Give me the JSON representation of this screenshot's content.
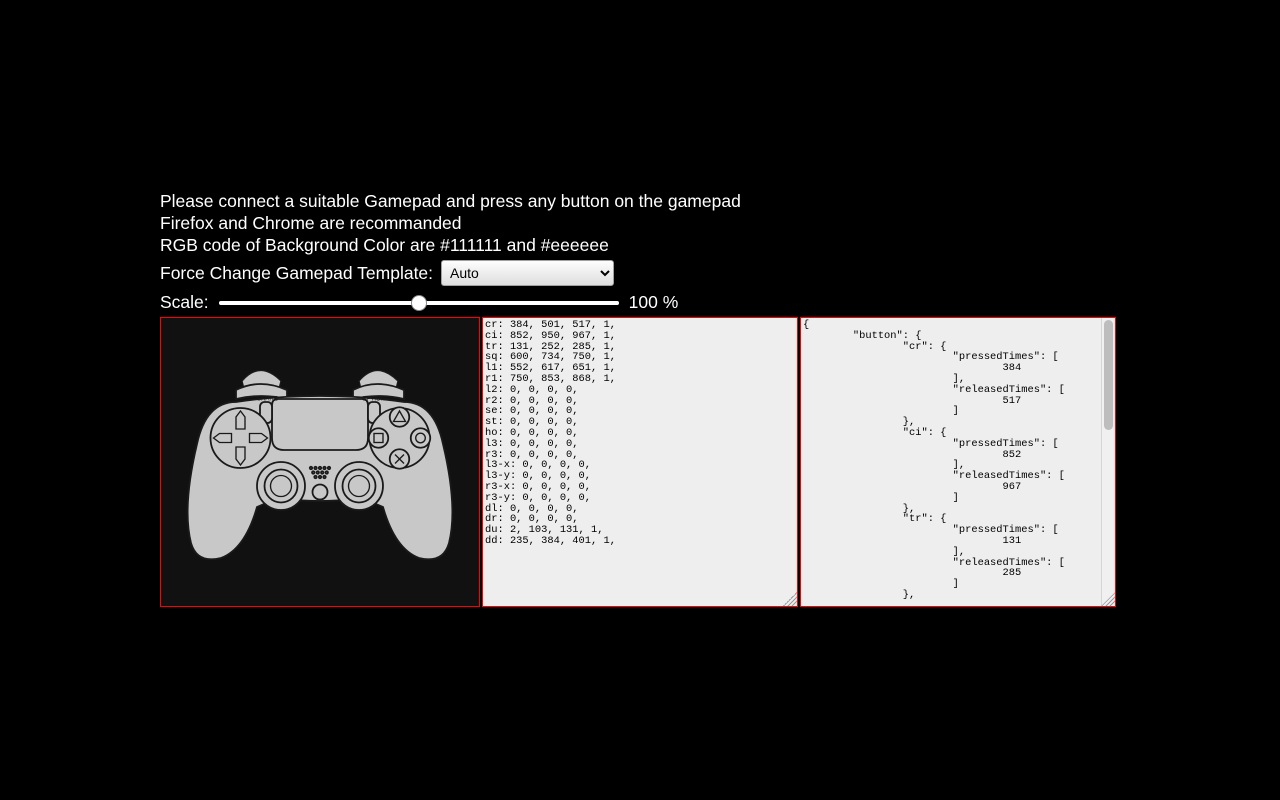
{
  "info": {
    "line1": "Please connect a suitable Gamepad and press any button on the gamepad",
    "line2": "Firefox and Chrome are recommanded",
    "line3": "RGB code of Background Color are #111111 and #eeeeee"
  },
  "template": {
    "label": "Force Change Gamepad Template:",
    "selected": "Auto"
  },
  "scale": {
    "label": "Scale:",
    "value": 100,
    "suffix": " %"
  },
  "raw_lines": [
    "cr: 384, 501, 517, 1,",
    "ci: 852, 950, 967, 1,",
    "tr: 131, 252, 285, 1,",
    "sq: 600, 734, 750, 1,",
    "l1: 552, 617, 651, 1,",
    "r1: 750, 853, 868, 1,",
    "l2: 0, 0, 0, 0,",
    "r2: 0, 0, 0, 0,",
    "se: 0, 0, 0, 0,",
    "st: 0, 0, 0, 0,",
    "ho: 0, 0, 0, 0,",
    "l3: 0, 0, 0, 0,",
    "r3: 0, 0, 0, 0,",
    "l3-x: 0, 0, 0, 0,",
    "l3-y: 0, 0, 0, 0,",
    "r3-x: 0, 0, 0, 0,",
    "r3-y: 0, 0, 0, 0,",
    "dl: 0, 0, 0, 0,",
    "dr: 0, 0, 0, 0,",
    "du: 2, 103, 131, 1,",
    "dd: 235, 384, 401, 1,"
  ],
  "json_visible": "{\n        \"button\": {\n                \"cr\": {\n                        \"pressedTimes\": [\n                                384\n                        ],\n                        \"releasedTimes\": [\n                                517\n                        ]\n                },\n                \"ci\": {\n                        \"pressedTimes\": [\n                                852\n                        ],\n                        \"releasedTimes\": [\n                                967\n                        ]\n                },\n                \"tr\": {\n                        \"pressedTimes\": [\n                                131\n                        ],\n                        \"releasedTimes\": [\n                                285\n                        ]\n                },"
}
